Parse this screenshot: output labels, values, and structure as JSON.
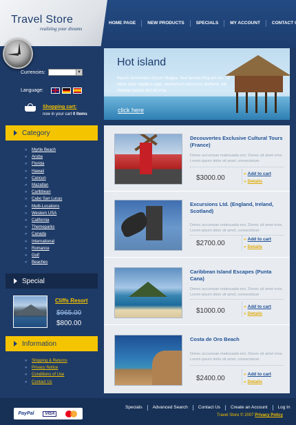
{
  "header": {
    "logo_title": "Travel Store",
    "logo_tagline": "realizing your dreams",
    "nav": [
      "HOME PAGE",
      "NEW PRODUCTS",
      "SPECIALS",
      "MY ACCOUNT",
      "CONTACT US"
    ]
  },
  "sidebar": {
    "currencies_label": "Currencies:",
    "currency_value": "",
    "language_label": "Language:",
    "languages": [
      "English flag",
      "German flag",
      "Spanish flag"
    ],
    "cart_title": "Shopping cart:",
    "cart_prefix": "now in your cart",
    "cart_count": "0",
    "cart_unit": "Items",
    "category_title": "Category",
    "categories": [
      "Myrtle Beach",
      "Aruba",
      "Florida",
      "Hawaii",
      "Cancun",
      "Mazatlan",
      "Caribbean",
      "Cabo San Lucas",
      "Multi-Locations",
      "Western USA",
      "California",
      "Themeparks",
      "Canada",
      "International",
      "Romance",
      "Golf",
      "Beaches"
    ],
    "special_title": "Special",
    "special": {
      "name": "Cliffs Resort",
      "old_price": "$965.00",
      "new_price": "$800.00"
    },
    "info_title": "Information",
    "info_links": [
      "Shipping & Returns",
      "Privacy Notice",
      "Conditions of Use",
      "Contact Us"
    ]
  },
  "banner": {
    "title": "Hot island",
    "text": "Mauris fermentum dictum Magna. Sed laoreet Aliquam leo. Ut tellus dolor dapibus eget, elementum velcursus eleifend, elit. Aenean auctor wisi et urna.",
    "link": "click here"
  },
  "products": [
    {
      "name": "Decouvertes Exclusive Cultural Tours (France)",
      "desc": "Donec accumsan malesuada orci. Donec sit amet eros. Lorem ipsum dolor sit amet, consectetuer",
      "price": "$3000.00",
      "cart": "Add to cart",
      "details": "Details"
    },
    {
      "name": "Excursions Ltd. (England, Ireland, Scotland)",
      "desc": "Donec accumsan malesuada orci. Donec sit amet eros. Lorem ipsum dolor sit amet, consectetuer",
      "price": "$2700.00",
      "cart": "Add to cart",
      "details": "Details"
    },
    {
      "name": "Caribbean Island Escapes (Punta Cana)",
      "desc": "Donec accumsan malesuada orci. Donec sit amet eros. Lorem ipsum dolor sit amet, consectetuer",
      "price": "$1000.00",
      "cart": "Add to cart",
      "details": "Details"
    },
    {
      "name": "Costa de Oro Beach",
      "desc": "Donec accumsan malesuada orci. Donec sit amet eros. Lorem ipsum dolor sit amet, consectetuer",
      "price": "$2400.00",
      "cart": "Add to cart",
      "details": "Details"
    }
  ],
  "footer": {
    "payment": [
      "PayPal",
      "VISA",
      "MasterCard"
    ],
    "links": [
      "Specials",
      "Advanced Search",
      "Contact Us",
      "Create an Account",
      "Log In"
    ],
    "copyright": "Travel Store © 2007",
    "privacy": "Privacy Policy"
  },
  "colors": {
    "background": "#1e3a66",
    "accent": "#f5c400",
    "link_blue": "#1e4f93"
  }
}
